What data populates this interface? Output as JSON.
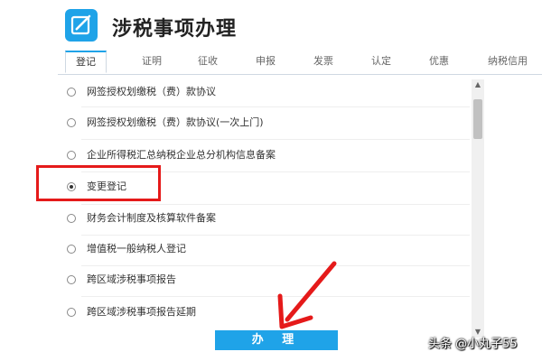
{
  "app": {
    "title": "涉税事项办理",
    "icon": "edit-note-icon",
    "accent_color": "#1fa3e8"
  },
  "tabs": [
    {
      "label": "登记",
      "active": true
    },
    {
      "label": "证明",
      "active": false
    },
    {
      "label": "征收",
      "active": false
    },
    {
      "label": "申报",
      "active": false
    },
    {
      "label": "发票",
      "active": false
    },
    {
      "label": "认定",
      "active": false
    },
    {
      "label": "优惠",
      "active": false
    },
    {
      "label": "纳税信用",
      "active": false
    }
  ],
  "items": [
    {
      "label": "网签授权划缴税（费）款协议",
      "selected": false
    },
    {
      "label": "网签授权划缴税（费）款协议(一次上门)",
      "selected": false
    },
    {
      "label": "企业所得税汇总纳税企业总分机构信息备案",
      "selected": false
    },
    {
      "label": "变更登记",
      "selected": true
    },
    {
      "label": "财务会计制度及核算软件备案",
      "selected": false
    },
    {
      "label": "增值税一般纳税人登记",
      "selected": false
    },
    {
      "label": "跨区域涉税事项报告",
      "selected": false
    },
    {
      "label": "跨区域涉税事项报告延期",
      "selected": false
    }
  ],
  "actions": {
    "submit_label": "办 理"
  },
  "annotations": {
    "highlight_color": "#e51a1a",
    "arrow_color": "#e51a1a"
  },
  "watermark": "头条 @小丸子55"
}
